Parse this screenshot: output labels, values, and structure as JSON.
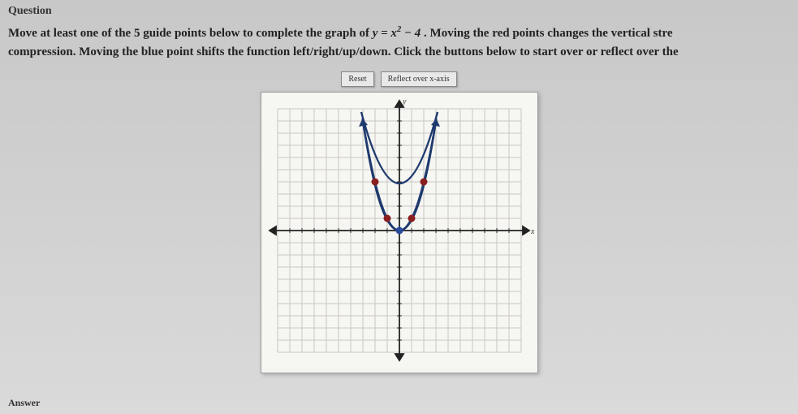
{
  "section_header": "Question",
  "instruction_line1_a": "Move at least one of the 5 guide points below to complete the graph of ",
  "instruction_eq": "y = x² − 4",
  "instruction_line1_b": ". Moving the red points changes the vertical stre",
  "instruction_line2": "compression. Moving the blue point shifts the function left/right/up/down. Click the buttons below to start over or reflect over the ",
  "buttons": {
    "reset": "Reset",
    "reflect": "Reflect over x-axis"
  },
  "axis": {
    "x": "x",
    "y": "y"
  },
  "footer": "Answer",
  "chart_data": {
    "type": "scatter",
    "title": "",
    "xlabel": "x",
    "ylabel": "y",
    "xlim": [
      -10,
      10
    ],
    "ylim": [
      -10,
      10
    ],
    "series": [
      {
        "name": "parabola y=x^2",
        "x": [
          -3,
          -2,
          -1,
          0,
          1,
          2,
          3
        ],
        "values": [
          9,
          4,
          1,
          0,
          1,
          4,
          9
        ]
      },
      {
        "name": "guide-points-red",
        "x": [
          -2,
          -1,
          1,
          2
        ],
        "values": [
          4,
          1,
          1,
          4
        ]
      },
      {
        "name": "guide-point-blue",
        "x": [
          0
        ],
        "values": [
          0
        ]
      }
    ]
  }
}
